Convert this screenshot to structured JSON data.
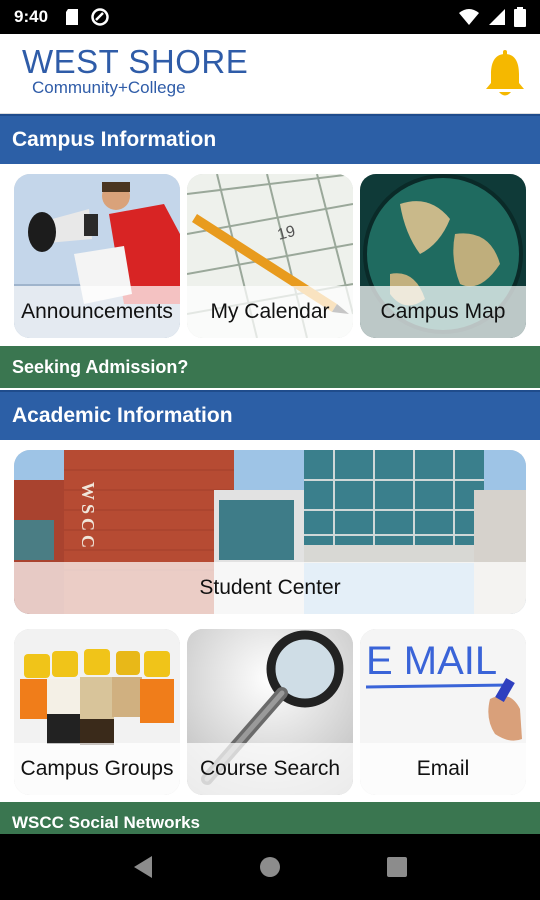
{
  "status_bar": {
    "time": "9:40"
  },
  "header": {
    "logo_line1": "WEST SHORE",
    "logo_line2": "Community+College"
  },
  "sections": {
    "campus_info": "Campus Information",
    "seeking_admission": "Seeking Admission?",
    "academic_info": "Academic Information",
    "social_networks": "WSCC Social Networks"
  },
  "tiles": {
    "announcements": "Announcements",
    "my_calendar": "My Calendar",
    "campus_map": "Campus Map",
    "student_center": "Student Center",
    "campus_groups": "Campus Groups",
    "course_search": "Course Search",
    "email": "Email"
  },
  "images": {
    "email_text": "E MAIL",
    "calendar_number": "19",
    "building_sign": "WSCC"
  },
  "colors": {
    "section_blue": "#2c5fa6",
    "section_green": "#3a7650",
    "bell": "#f5b800",
    "logo": "#2f5ca8"
  }
}
